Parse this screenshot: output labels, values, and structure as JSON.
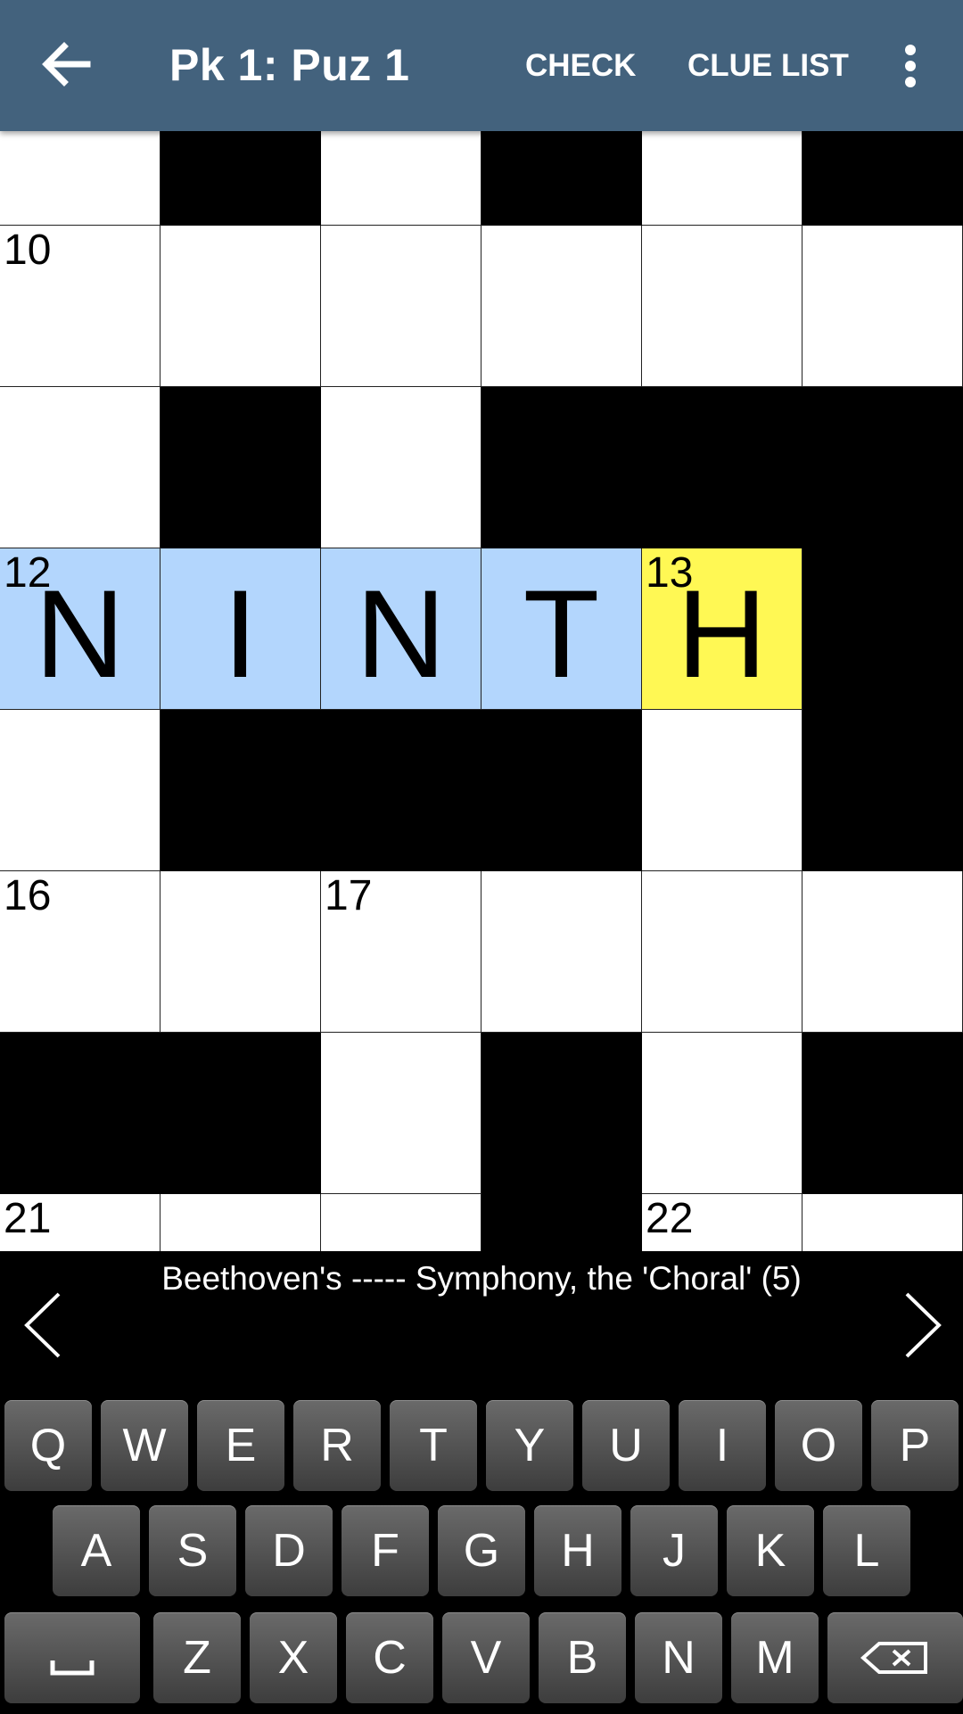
{
  "header": {
    "title": "Pk 1: Puz 1",
    "check_label": "CHECK",
    "clue_list_label": "CLUE LIST",
    "back_icon": "arrow-left-icon",
    "overflow_icon": "more-vert-icon"
  },
  "grid": {
    "columns": 6,
    "rows": [
      [
        {
          "t": "w"
        },
        {
          "t": "b"
        },
        {
          "t": "w"
        },
        {
          "t": "b"
        },
        {
          "t": "w"
        },
        {
          "t": "b"
        }
      ],
      [
        {
          "t": "w",
          "n": "10"
        },
        {
          "t": "w"
        },
        {
          "t": "w"
        },
        {
          "t": "w"
        },
        {
          "t": "w"
        },
        {
          "t": "w"
        }
      ],
      [
        {
          "t": "w"
        },
        {
          "t": "b"
        },
        {
          "t": "w"
        },
        {
          "t": "b"
        },
        {
          "t": "b"
        },
        {
          "t": "b"
        }
      ],
      [
        {
          "t": "w",
          "n": "12",
          "l": "N",
          "h": "word"
        },
        {
          "t": "w",
          "l": "I",
          "h": "word"
        },
        {
          "t": "w",
          "l": "N",
          "h": "word"
        },
        {
          "t": "w",
          "l": "T",
          "h": "word"
        },
        {
          "t": "w",
          "n": "13",
          "l": "H",
          "h": "cursor"
        },
        {
          "t": "b"
        }
      ],
      [
        {
          "t": "w"
        },
        {
          "t": "b"
        },
        {
          "t": "b"
        },
        {
          "t": "b"
        },
        {
          "t": "w"
        },
        {
          "t": "b"
        }
      ],
      [
        {
          "t": "w",
          "n": "16"
        },
        {
          "t": "w"
        },
        {
          "t": "w",
          "n": "17"
        },
        {
          "t": "w"
        },
        {
          "t": "w"
        },
        {
          "t": "w"
        }
      ],
      [
        {
          "t": "b"
        },
        {
          "t": "b"
        },
        {
          "t": "w"
        },
        {
          "t": "b"
        },
        {
          "t": "w"
        },
        {
          "t": "b"
        }
      ],
      [
        {
          "t": "w",
          "n": "21"
        },
        {
          "t": "w"
        },
        {
          "t": "w"
        },
        {
          "t": "b"
        },
        {
          "t": "w",
          "n": "22"
        },
        {
          "t": "w"
        }
      ]
    ],
    "colors": {
      "word_highlight": "#b3d6fd",
      "cursor_highlight": "#fff854",
      "block": "#000000",
      "open": "#ffffff"
    }
  },
  "clue": {
    "text": "Beethoven's ----- Symphony, the 'Choral' (5)",
    "prev_icon": "chevron-left-icon",
    "next_icon": "chevron-right-icon"
  },
  "keyboard": {
    "rows": [
      [
        "Q",
        "W",
        "E",
        "R",
        "T",
        "Y",
        "U",
        "I",
        "O",
        "P"
      ],
      [
        "A",
        "S",
        "D",
        "F",
        "G",
        "H",
        "J",
        "K",
        "L"
      ],
      [
        "␣",
        "Z",
        "X",
        "C",
        "V",
        "B",
        "N",
        "M",
        "⌫"
      ]
    ],
    "space_icon": "space-icon",
    "backspace_icon": "backspace-icon"
  },
  "theme": {
    "appbar_color": "#43627d"
  }
}
